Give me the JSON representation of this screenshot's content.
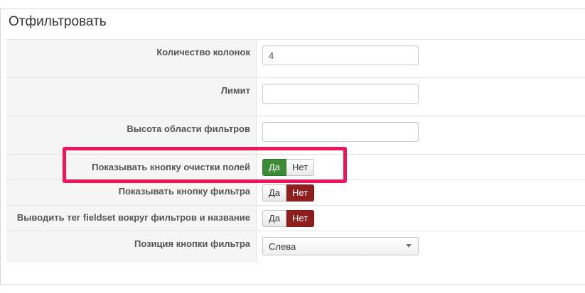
{
  "fieldset": {
    "legend": "Отфильтровать"
  },
  "rows": [
    {
      "label": "Количество колонок",
      "control": "text",
      "value": "4"
    },
    {
      "label": "Лимит",
      "control": "text",
      "value": ""
    },
    {
      "label": "Высота области фильтров",
      "control": "text",
      "value": ""
    },
    {
      "label": "Показывать кнопку очистки полей",
      "control": "toggle",
      "yes_label": "Да",
      "no_label": "Нет",
      "selected": "yes"
    },
    {
      "label": "Показывать кнопку фильтра",
      "control": "toggle",
      "yes_label": "Да",
      "no_label": "Нет",
      "selected": "no"
    },
    {
      "label": "Выводить тег fieldset вокруг фильтров и название",
      "control": "toggle",
      "yes_label": "Да",
      "no_label": "Нет",
      "selected": "no"
    },
    {
      "label": "Позиция кнопки фильтра",
      "control": "select",
      "value": "Слева"
    }
  ],
  "colors": {
    "highlight": "#f0145a",
    "yes_active": "#3b8b37",
    "no_active": "#8f1f1f"
  }
}
